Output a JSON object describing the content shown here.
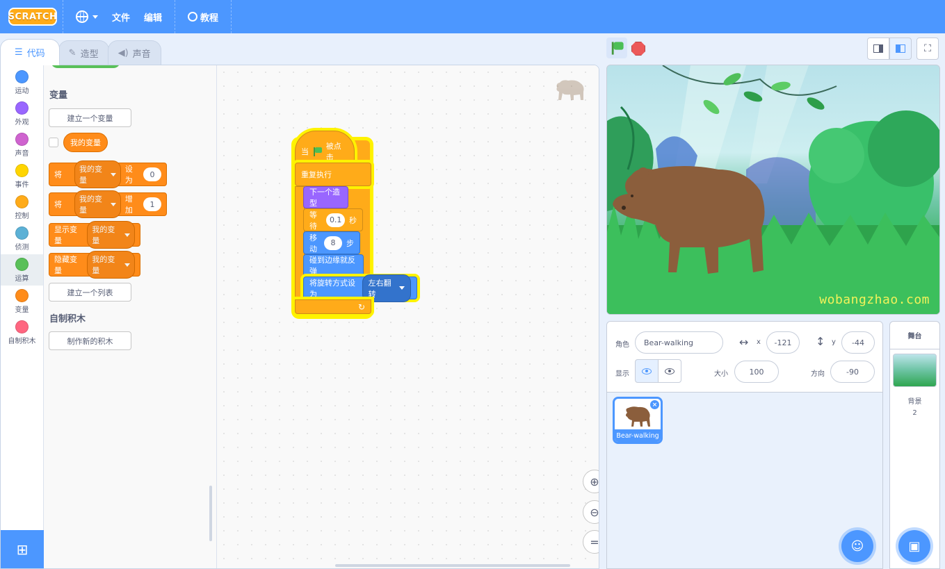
{
  "menubar": {
    "logo_text": "SCRATCH",
    "file": "文件",
    "edit": "编辑",
    "tutorials": "教程"
  },
  "tabs": [
    {
      "label": "代码",
      "icon": "code-icon",
      "active": true
    },
    {
      "label": "造型",
      "icon": "brush-icon",
      "active": false
    },
    {
      "label": "声音",
      "icon": "speaker-icon",
      "active": false
    }
  ],
  "categories": [
    {
      "label": "运动",
      "color": "#4c97ff"
    },
    {
      "label": "外观",
      "color": "#9966ff"
    },
    {
      "label": "声音",
      "color": "#cf63cf"
    },
    {
      "label": "事件",
      "color": "#ffd500"
    },
    {
      "label": "控制",
      "color": "#ffab19"
    },
    {
      "label": "侦测",
      "color": "#5cb1d6"
    },
    {
      "label": "运算",
      "color": "#59c059"
    },
    {
      "label": "变量",
      "color": "#ff8c1a"
    },
    {
      "label": "自制积木",
      "color": "#ff6680"
    }
  ],
  "palette": {
    "variables_heading": "变量",
    "make_variable": "建立一个变量",
    "my_variable": "我的变量",
    "set_block": {
      "prefix": "将",
      "var": "我的变量",
      "mid": "设为",
      "value": "0"
    },
    "change_block": {
      "prefix": "将",
      "var": "我的变量",
      "mid": "增加",
      "value": "1"
    },
    "show_block": {
      "label": "显示变量",
      "var": "我的变量"
    },
    "hide_block": {
      "label": "隐藏变量",
      "var": "我的变量"
    },
    "make_list": "建立一个列表",
    "my_blocks_heading": "自制积木",
    "make_block": "制作新的积木"
  },
  "script": {
    "hat": {
      "prefix": "当",
      "suffix": "被点击"
    },
    "forever": "重复执行",
    "next_costume": "下一个造型",
    "wait": {
      "prefix": "等待",
      "value": "0.1",
      "suffix": "秒"
    },
    "move": {
      "prefix": "移动",
      "value": "8",
      "suffix": "步"
    },
    "bounce": "碰到边缘就反弹",
    "rotation": {
      "prefix": "将旋转方式设为",
      "value": "左右翻转"
    }
  },
  "stage": {
    "watermark": "wobangzhao.com"
  },
  "sprite_info": {
    "sprite_label": "角色",
    "sprite_name": "Bear-walking",
    "x_label": "x",
    "x_value": "-121",
    "y_label": "y",
    "y_value": "-44",
    "show_label": "显示",
    "size_label": "大小",
    "size_value": "100",
    "direction_label": "方向",
    "direction_value": "-90"
  },
  "sprites": [
    {
      "name": "Bear-walking",
      "selected": true
    }
  ],
  "stage_pane": {
    "title": "舞台",
    "backdrops_label": "背景",
    "backdrops_count": "2"
  }
}
